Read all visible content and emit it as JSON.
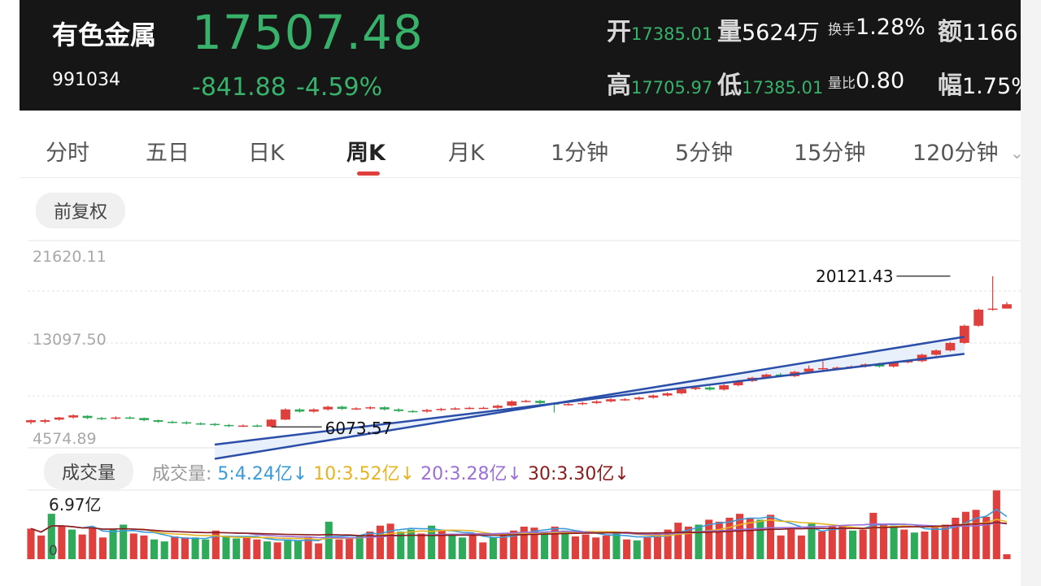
{
  "header": {
    "name": "有色金属",
    "code": "991034",
    "price": "17507.48",
    "change": "-841.88",
    "change_pct": "-4.59%",
    "open_label": "开",
    "open_value": "17385.01",
    "vol_label": "量",
    "vol_value": "5624万",
    "turnover_label": "换手",
    "turnover_value": "1.28%",
    "amount_label": "额",
    "amount_value": "1166",
    "high_label": "高",
    "high_value": "17705.97",
    "low_label": "低",
    "low_value": "17385.01",
    "volratio_label": "量比",
    "volratio_value": "0.80",
    "amp_label": "幅",
    "amp_value": "1.75%"
  },
  "tabs": [
    "分时",
    "五日",
    "日K",
    "周K",
    "月K",
    "1分钟",
    "5分钟",
    "15分钟",
    "120分钟"
  ],
  "active_tab": "周K",
  "adjust_label": "前复权",
  "volume_label": "成交量",
  "ma_prefix": "成交量:",
  "ma": [
    {
      "text": "5:4.24亿",
      "color": "#3a9bd9"
    },
    {
      "text": "10:3.52亿",
      "color": "#e6b422"
    },
    {
      "text": "20:3.28亿",
      "color": "#9b6fd6"
    },
    {
      "text": "30:3.30亿",
      "color": "#8b1a1a"
    }
  ],
  "colors": {
    "up": "#e0403d",
    "down": "#2faa5a",
    "channel": "#2b4ea8",
    "price_green": "#38b26a"
  },
  "chart_data": {
    "type": "candlestick",
    "y_axis_labels": [
      "21620.11",
      "13097.50",
      "4574.89"
    ],
    "ylim": [
      4574.89,
      21620.11
    ],
    "annotations": [
      {
        "text": "20121.43",
        "kind": "max",
        "index": 65
      },
      {
        "text": "6073.57",
        "kind": "min",
        "index": 17
      }
    ],
    "channel": {
      "upper": [
        [
          13,
          3100
        ],
        [
          66,
          14470
        ]
      ],
      "lower": [
        [
          13,
          4420
        ],
        [
          66,
          12880
        ]
      ]
    },
    "candles": [
      [
        6500,
        6700,
        6320,
        6750
      ],
      [
        6550,
        6700,
        6400,
        6800
      ],
      [
        6750,
        6950,
        6650,
        7000
      ],
      [
        6950,
        7150,
        6850,
        7250
      ],
      [
        7100,
        6900,
        6800,
        7150
      ],
      [
        6900,
        6850,
        6700,
        7000
      ],
      [
        6850,
        6950,
        6750,
        7050
      ],
      [
        6950,
        6900,
        6800,
        7050
      ],
      [
        6900,
        6700,
        6600,
        6950
      ],
      [
        6700,
        6550,
        6450,
        6750
      ],
      [
        6550,
        6500,
        6400,
        6650
      ],
      [
        6500,
        6400,
        6300,
        6600
      ],
      [
        6400,
        6350,
        6250,
        6500
      ],
      [
        6350,
        6250,
        6150,
        6450
      ],
      [
        6250,
        6150,
        6050,
        6350
      ],
      [
        6150,
        6200,
        6050,
        6300
      ],
      [
        6200,
        6150,
        6050,
        6300
      ],
      [
        6100,
        6750,
        6073,
        6800
      ],
      [
        6750,
        7700,
        6700,
        7800
      ],
      [
        7700,
        7500,
        7400,
        7800
      ],
      [
        7500,
        7700,
        7400,
        7800
      ],
      [
        7700,
        7950,
        7600,
        8050
      ],
      [
        7950,
        7750,
        7650,
        8050
      ],
      [
        7750,
        7800,
        7650,
        7900
      ],
      [
        7800,
        7900,
        7700,
        8000
      ],
      [
        7900,
        7700,
        7600,
        8000
      ],
      [
        7700,
        7550,
        7450,
        7800
      ],
      [
        7550,
        7500,
        7400,
        7650
      ],
      [
        7500,
        7650,
        7400,
        7750
      ],
      [
        7650,
        7750,
        7550,
        7850
      ],
      [
        7750,
        7800,
        7650,
        7900
      ],
      [
        7800,
        7850,
        7700,
        7950
      ],
      [
        7850,
        7850,
        7750,
        7950
      ],
      [
        7850,
        8050,
        7750,
        8150
      ],
      [
        8050,
        8450,
        7950,
        8550
      ],
      [
        8450,
        8500,
        8350,
        8600
      ],
      [
        8500,
        8300,
        8200,
        8600
      ],
      [
        8300,
        8150,
        7400,
        8350
      ],
      [
        8150,
        8200,
        8050,
        8300
      ],
      [
        8200,
        8300,
        8100,
        8400
      ],
      [
        8300,
        8450,
        8200,
        8550
      ],
      [
        8450,
        8650,
        8350,
        8750
      ],
      [
        8650,
        8650,
        8500,
        8750
      ],
      [
        8650,
        8800,
        8550,
        8900
      ],
      [
        8800,
        9000,
        8700,
        9100
      ],
      [
        9000,
        9200,
        8900,
        9300
      ],
      [
        9200,
        9600,
        9100,
        9700
      ],
      [
        9600,
        9750,
        9500,
        9850
      ],
      [
        9750,
        9550,
        9450,
        9850
      ],
      [
        9550,
        9950,
        9450,
        10050
      ],
      [
        9950,
        10350,
        9850,
        10450
      ],
      [
        10350,
        10650,
        10250,
        10750
      ],
      [
        10650,
        10950,
        10550,
        11050
      ],
      [
        10950,
        10800,
        10700,
        11100
      ],
      [
        10800,
        11200,
        10700,
        11300
      ],
      [
        11200,
        11500,
        11100,
        11800
      ],
      [
        11500,
        11550,
        11300,
        12200
      ],
      [
        11550,
        11600,
        11450,
        11700
      ],
      [
        11600,
        11700,
        11500,
        11800
      ],
      [
        11700,
        11900,
        11600,
        12000
      ],
      [
        11900,
        11700,
        11600,
        12050
      ],
      [
        11700,
        12100,
        11600,
        12200
      ],
      [
        12100,
        12200,
        12000,
        12300
      ],
      [
        12200,
        12800,
        12100,
        12900
      ],
      [
        12800,
        13200,
        12700,
        13300
      ],
      [
        13200,
        13900,
        13100,
        14000
      ],
      [
        13900,
        15500,
        13800,
        15600
      ],
      [
        15500,
        17000,
        15400,
        17100
      ],
      [
        17000,
        17100,
        16900,
        20121
      ],
      [
        17100,
        17507,
        17385,
        17706
      ]
    ],
    "volumes": [
      [
        3.1,
        1
      ],
      [
        2.4,
        1
      ],
      [
        4.6,
        0
      ],
      [
        3.4,
        1
      ],
      [
        3.0,
        0
      ],
      [
        2.5,
        1
      ],
      [
        3.2,
        1
      ],
      [
        2.2,
        1
      ],
      [
        3.0,
        0
      ],
      [
        3.5,
        0
      ],
      [
        2.6,
        1
      ],
      [
        2.4,
        1
      ],
      [
        2.0,
        0
      ],
      [
        1.8,
        0
      ],
      [
        2.3,
        1
      ],
      [
        2.2,
        1
      ],
      [
        2.2,
        0
      ],
      [
        2.0,
        0
      ],
      [
        2.9,
        1
      ],
      [
        2.3,
        0
      ],
      [
        2.1,
        0
      ],
      [
        2.2,
        1
      ],
      [
        2.0,
        1
      ],
      [
        1.8,
        0
      ],
      [
        1.7,
        1
      ],
      [
        2.0,
        0
      ],
      [
        1.9,
        0
      ],
      [
        2.2,
        1
      ],
      [
        1.6,
        1
      ],
      [
        3.8,
        0
      ],
      [
        2.0,
        1
      ],
      [
        2.2,
        1
      ],
      [
        2.4,
        0
      ],
      [
        2.8,
        1
      ],
      [
        3.4,
        1
      ],
      [
        3.6,
        1
      ],
      [
        2.8,
        0
      ],
      [
        3.0,
        0
      ],
      [
        2.6,
        1
      ],
      [
        3.4,
        0
      ],
      [
        2.9,
        1
      ],
      [
        2.5,
        0
      ],
      [
        2.2,
        0
      ],
      [
        2.4,
        1
      ],
      [
        1.7,
        1
      ],
      [
        2.2,
        0
      ],
      [
        2.6,
        1
      ],
      [
        2.9,
        1
      ],
      [
        3.3,
        1
      ],
      [
        3.2,
        1
      ],
      [
        2.8,
        0
      ],
      [
        3.3,
        1
      ],
      [
        2.9,
        0
      ],
      [
        2.3,
        1
      ],
      [
        2.5,
        1
      ],
      [
        2.2,
        1
      ],
      [
        2.4,
        1
      ],
      [
        2.8,
        0
      ],
      [
        2.0,
        1
      ],
      [
        1.9,
        0
      ],
      [
        2.2,
        1
      ],
      [
        2.6,
        1
      ],
      [
        3.0,
        1
      ],
      [
        3.7,
        1
      ],
      [
        3.3,
        1
      ],
      [
        3.5,
        0
      ],
      [
        4.0,
        1
      ],
      [
        3.8,
        1
      ],
      [
        4.2,
        1
      ],
      [
        4.6,
        1
      ],
      [
        4.2,
        1
      ],
      [
        4.0,
        0
      ],
      [
        4.5,
        1
      ],
      [
        2.4,
        1
      ],
      [
        3.0,
        1
      ],
      [
        2.4,
        1
      ],
      [
        3.6,
        0
      ],
      [
        2.8,
        1
      ],
      [
        3.3,
        1
      ],
      [
        3.4,
        1
      ],
      [
        2.9,
        0
      ],
      [
        3.0,
        1
      ],
      [
        4.7,
        1
      ],
      [
        3.6,
        1
      ],
      [
        3.4,
        0
      ],
      [
        3.0,
        1
      ],
      [
        2.7,
        0
      ],
      [
        2.8,
        1
      ],
      [
        3.2,
        1
      ],
      [
        3.5,
        1
      ],
      [
        4.2,
        1
      ],
      [
        4.8,
        1
      ],
      [
        5.0,
        1
      ],
      [
        4.3,
        1
      ],
      [
        6.97,
        1
      ],
      [
        0.5,
        1
      ]
    ],
    "volume_max_label": "6.97亿",
    "volume_zero_label": "0",
    "volume_ylim": [
      0,
      7
    ]
  }
}
